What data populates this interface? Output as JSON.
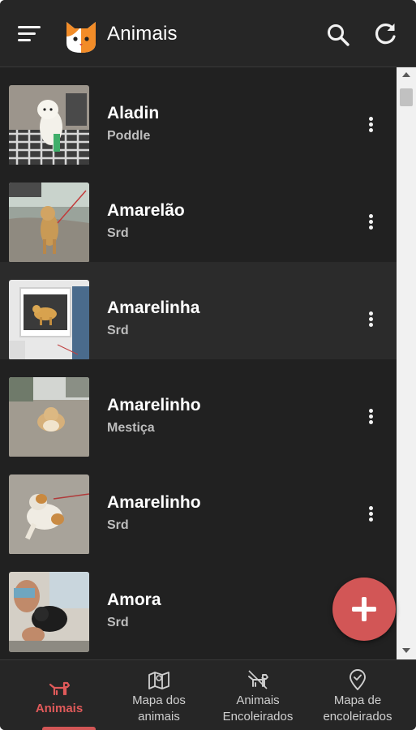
{
  "header": {
    "title": "Animais",
    "menu_icon": "menu-icon",
    "search_icon": "search-icon",
    "refresh_icon": "refresh-icon"
  },
  "animals": [
    {
      "name": "Aladin",
      "breed": "Poddle"
    },
    {
      "name": "Amarelão",
      "breed": "Srd"
    },
    {
      "name": "Amarelinha",
      "breed": "Srd"
    },
    {
      "name": "Amarelinho",
      "breed": "Mestiça"
    },
    {
      "name": "Amarelinho",
      "breed": "Srd"
    },
    {
      "name": "Amora",
      "breed": "Srd"
    }
  ],
  "fab": {
    "icon": "plus-icon"
  },
  "bottom_nav": [
    {
      "label": "Animais",
      "icon": "dog-icon",
      "active": true
    },
    {
      "label": "Mapa dos animais",
      "label_line1": "Mapa dos",
      "label_line2": "animais",
      "icon": "map-icon"
    },
    {
      "label": "Animais Encoleirados",
      "label_line1": "Animais",
      "label_line2": "Encoleirados",
      "icon": "collared-dog-icon"
    },
    {
      "label": "Mapa de encoleirados",
      "label_line1": "Mapa de",
      "label_line2": "encoleirados",
      "icon": "location-pin-icon"
    }
  ],
  "colors": {
    "background": "#212121",
    "bar": "#262626",
    "accent": "#d25656"
  }
}
